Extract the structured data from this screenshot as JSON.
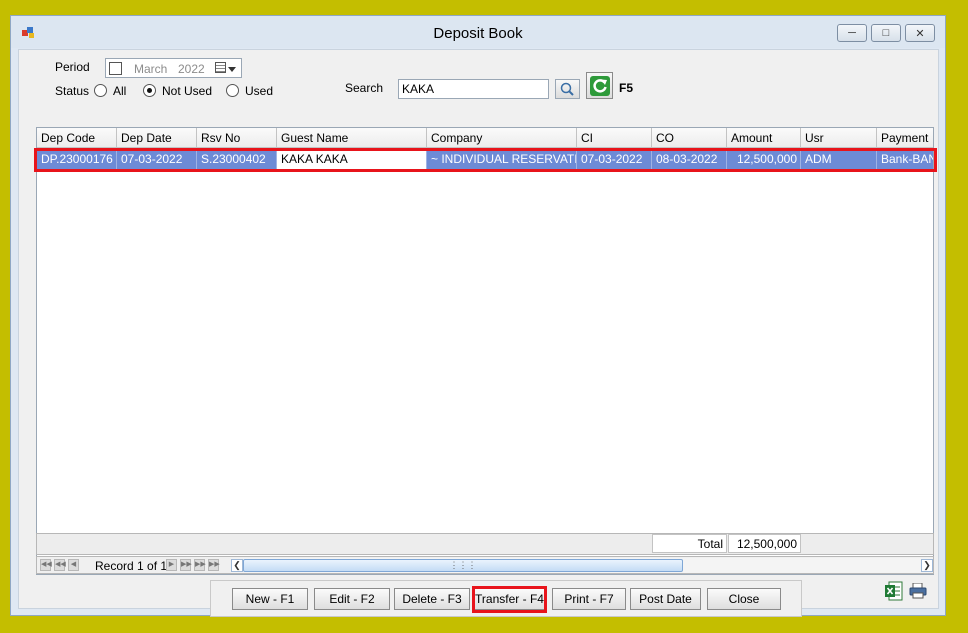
{
  "window": {
    "title": "Deposit Book"
  },
  "filter": {
    "period_label": "Period",
    "period_month": "March",
    "period_year": "2022",
    "status_label": "Status",
    "status_options": [
      "All",
      "Not Used",
      "Used"
    ],
    "status_selected": "Not Used",
    "search_label": "Search",
    "search_value": "KAKA",
    "refresh_shortcut": "F5"
  },
  "grid": {
    "columns": [
      "Dep Code",
      "Dep Date",
      "Rsv No",
      "Guest Name",
      "Company",
      "CI",
      "CO",
      "Amount",
      "Usr",
      "Payment"
    ],
    "rows": [
      {
        "dep_code": "DP.23000176",
        "dep_date": "07-03-2022",
        "rsv_no": "S.23000402",
        "guest_name": "KAKA KAKA",
        "company": "~ INDIVIDUAL RESERVATI...",
        "ci": "07-03-2022",
        "co": "08-03-2022",
        "amount": "12,500,000",
        "usr": "ADM",
        "payment": "Bank-BANK"
      }
    ],
    "total_label": "Total",
    "total_value": "12,500,000",
    "record_text": "Record 1 of 1",
    "selection_color": "#6d8bd6"
  },
  "actions": {
    "new": "New - F1",
    "edit": "Edit - F2",
    "delete": "Delete - F3",
    "transfer": "Transfer - F4",
    "print": "Print - F7",
    "post_date": "Post Date",
    "close": "Close"
  },
  "highlight_color": "#e8141b"
}
